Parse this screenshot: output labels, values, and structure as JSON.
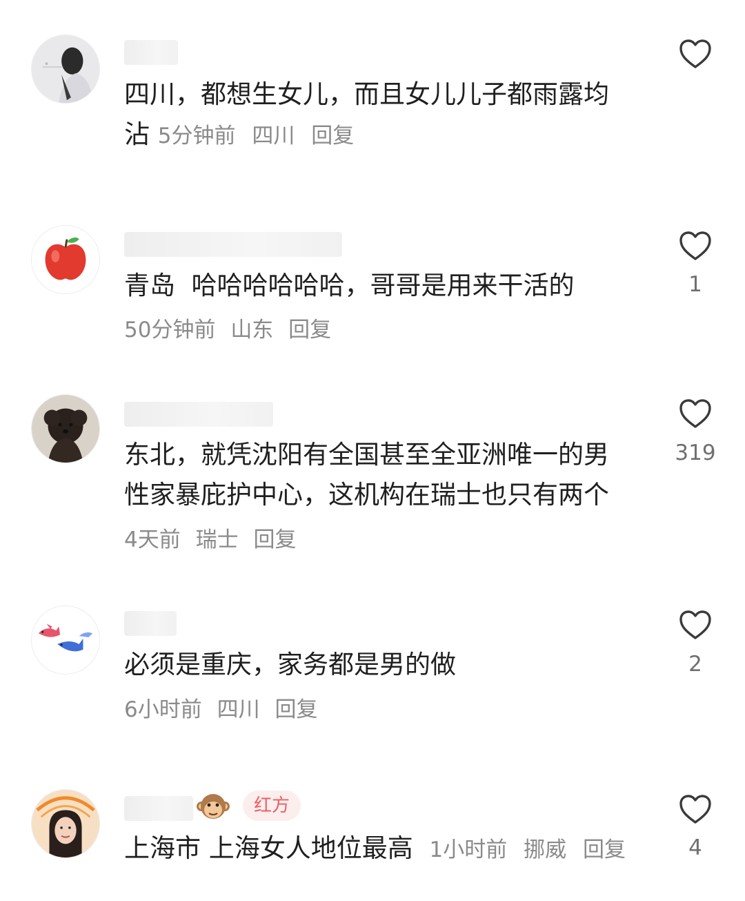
{
  "comments": [
    {
      "avatar": "portrait-avatar",
      "text": "四川，都想生女儿，而且女儿儿子都雨露均沾",
      "text_line1": "四川，都想生女儿，而且女儿儿子都雨露均",
      "text_line2": "沾",
      "time": "5分钟前",
      "location": "四川",
      "reply": "回复",
      "likes": ""
    },
    {
      "avatar": "apple-avatar",
      "text": "青岛  哈哈哈哈哈哈，哥哥是用来干活的",
      "time": "50分钟前",
      "location": "山东",
      "reply": "回复",
      "likes": "1"
    },
    {
      "avatar": "dog-avatar",
      "text": "东北，就凭沈阳有全国甚至全亚洲唯一的男性家暴庇护中心，这机构在瑞士也只有两个",
      "text_line1": "东北，就凭沈阳有全国甚至全亚洲唯一的男",
      "text_line2": "性家暴庇护中心，这机构在瑞士也只有两个",
      "time": "4天前",
      "location": "瑞士",
      "reply": "回复",
      "likes": "319"
    },
    {
      "avatar": "fish-avatar",
      "text": "必须是重庆，家务都是男的做",
      "time": "6小时前",
      "location": "四川",
      "reply": "回复",
      "likes": "2"
    },
    {
      "avatar": "woman-avatar",
      "badge": "红方",
      "badge_emoji": "monkey-icon",
      "text": "上海市 上海女人地位最高",
      "time": "1小时前",
      "location": "挪威",
      "reply": "回复",
      "likes": "4"
    }
  ],
  "colors": {
    "text": "#1f1f1f",
    "meta": "#8a8a8a",
    "badge_bg": "#fdeeee",
    "badge_fg": "#ea5f63"
  }
}
